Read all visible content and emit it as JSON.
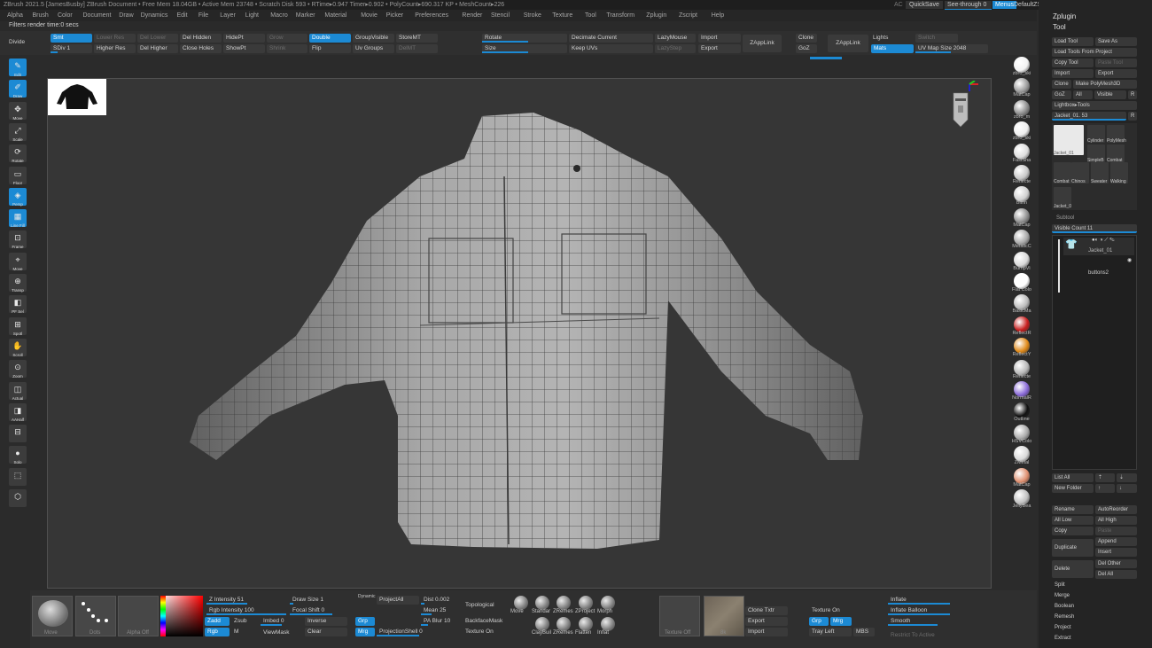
{
  "titlebar": {
    "text": "ZBrush 2021.5 [JamesBusby]  ZBrush Document    • Free Mem 18.04GB • Active Mem 23748 • Scratch Disk 593 • RTime▸0.947 Timer▸0.902 • PolyCount▸690.317 KP • MeshCount▸226",
    "ac": "AC",
    "quicksave": "QuickSave",
    "seethrough": "See-through  0",
    "menus": "Menus",
    "defaultzscript": "DefaultZScript"
  },
  "menubar": [
    "Alpha",
    "Brush",
    "Color",
    "Document",
    "Draw",
    "Dynamics",
    "Edit",
    "File",
    "Layer",
    "Light",
    "Macro",
    "Marker",
    "Material",
    "Movie",
    "Picker",
    "Preferences",
    "Render",
    "Stencil",
    "Stroke",
    "Texture",
    "Tool",
    "Transform",
    "Zplugin",
    "Zscript",
    "Help"
  ],
  "notice": "Filters render time:0 secs",
  "top_palette": {
    "divide": "Divide",
    "sdiv_label": "Smt",
    "sdiv_value": "SDiv 1",
    "lower_res": "Lower Res",
    "higher_res": "Higher Res",
    "del_lower": "Del Lower",
    "del_higher": "Del Higher",
    "del_hidden": "Del Hidden",
    "close_holes": "Close Holes",
    "hide_pt": "HidePt",
    "show_pt": "ShowPt",
    "grow": "Grow",
    "shrink": "Shrink",
    "double": "Double",
    "flip": "Flip",
    "group_visible": "GroupVisible",
    "uv_groups": "Uv Groups",
    "store_mt": "StoreMT",
    "del_mt": "DelMT",
    "rotate": "Rotate",
    "size": "Size",
    "decimate_current": "Decimate Current",
    "keep_uvs": "Keep UVs",
    "lazymouse": "LazyMouse",
    "lazystep": "LazyStep",
    "import": "Import",
    "export": "Export",
    "zapplink": "ZAppLink",
    "clone": "Clone",
    "goz": "GoZ",
    "zapplink2": "ZAppLink",
    "lights": "Lights",
    "switch": "Switch",
    "mats": "Mats",
    "uv_map_size": "UV Map Size 2048"
  },
  "left_shelf": [
    {
      "glyph": "✎",
      "cap": "Edit",
      "on": true
    },
    {
      "glyph": "✐",
      "cap": "Draw",
      "on": true
    },
    {
      "glyph": "✥",
      "cap": "Move",
      "on": false
    },
    {
      "glyph": "⤢",
      "cap": "Scale",
      "on": false
    },
    {
      "glyph": "⟳",
      "cap": "Rotate",
      "on": false
    },
    {
      "glyph": "▭",
      "cap": "Floor",
      "on": false
    },
    {
      "glyph": "◈",
      "cap": "Persp",
      "on": true
    },
    {
      "glyph": "▦",
      "cap": "Line Fill",
      "on": true
    },
    {
      "glyph": "⊡",
      "cap": "Frame",
      "on": false
    },
    {
      "glyph": "⌖",
      "cap": "Move",
      "on": false
    },
    {
      "glyph": "⊕",
      "cap": "Transp",
      "on": false
    },
    {
      "glyph": "◧",
      "cap": "PF Sel",
      "on": false
    },
    {
      "glyph": "⊞",
      "cap": "Spotl",
      "on": false
    },
    {
      "glyph": "✋",
      "cap": "Scroll",
      "on": false
    },
    {
      "glyph": "⊙",
      "cap": "Zoom",
      "on": false
    },
    {
      "glyph": "◫",
      "cap": "Actual",
      "on": false
    },
    {
      "glyph": "◨",
      "cap": "AAHalf",
      "on": false
    },
    {
      "glyph": "⊟",
      "cap": "",
      "on": false
    },
    {
      "glyph": "●",
      "cap": "Solo",
      "on": false
    },
    {
      "glyph": "⬚",
      "cap": "",
      "on": false
    },
    {
      "glyph": "⬡",
      "cap": "",
      "on": false
    }
  ],
  "materials": [
    {
      "name": "zbro_ski",
      "color": "#f2f2f2"
    },
    {
      "name": "MatCap",
      "color": "#9a9a9a"
    },
    {
      "name": "zbro_m",
      "color": "#8c8c8c"
    },
    {
      "name": "zbro_ski",
      "color": "#eeeeee"
    },
    {
      "name": "FastSha",
      "color": "#dddddd"
    },
    {
      "name": "Reflecte",
      "color": "#c8c8c8"
    },
    {
      "name": "Blinn",
      "color": "#d0d0d0"
    },
    {
      "name": "MatCap",
      "color": "#8f8f8f"
    },
    {
      "name": "MetalicC",
      "color": "#a8a8a8"
    },
    {
      "name": "BumpVi",
      "color": "#d8d8d8"
    },
    {
      "name": "Flat Colo",
      "color": "#ffffff"
    },
    {
      "name": "BasicMa",
      "color": "#bbbbbb"
    },
    {
      "name": "ReflectR",
      "color": "#c81f1f"
    },
    {
      "name": "ReflectY",
      "color": "#e08a1a"
    },
    {
      "name": "Reflecte",
      "color": "#b8b8b8"
    },
    {
      "name": "NormalR",
      "color": "#8a6ad8"
    },
    {
      "name": "Outline",
      "color": "#111111"
    },
    {
      "name": "HSVColo",
      "color": "#aaaaaa"
    },
    {
      "name": "ZMetal",
      "color": "#d9d9d9"
    },
    {
      "name": "MatCap",
      "color": "#e09070"
    },
    {
      "name": "JellyBea",
      "color": "#c0c0c0"
    }
  ],
  "right_panel": {
    "zplugin": "Zplugin",
    "tool": "Tool",
    "load_tool": "Load Tool",
    "save_as": "Save As",
    "load_tools_from_project": "Load Tools From Project",
    "copy_tool": "Copy Tool",
    "paste_tool": "Paste Tool",
    "import": "Import",
    "export": "Export",
    "clone": "Clone",
    "make_polymesh": "Make PolyMesh3D",
    "goz": "GoZ",
    "all": "All",
    "visible": "Visible",
    "r": "R",
    "lightbox_tools": "Lightbox▸Tools",
    "current_tool": "Jacket_01. 53",
    "tool_thumbs": [
      "Jacket_01",
      "Cylinder",
      "PolyMesh",
      "SimpleB",
      "Combat",
      "Combat",
      "Chinos",
      "Sweater",
      "Walking",
      "Jacket_0"
    ],
    "subtool": "Subtool",
    "visible_count": "Visible Count 11",
    "subtool_items": [
      "Jacket_01",
      "buttons2"
    ],
    "list_all": "List All",
    "new_folder": "New Folder",
    "rename": "Rename",
    "auto_reorder": "AutoReorder",
    "all_low": "All Low",
    "all_high": "All High",
    "copy": "Copy",
    "paste": "Paste",
    "duplicate": "Duplicate",
    "append": "Append",
    "insert": "Insert",
    "delete": "Delete",
    "del_other": "Del Other",
    "del_all": "Del All",
    "split": "Split",
    "merge": "Merge",
    "boolean": "Boolean",
    "remesh": "Remesh",
    "project": "Project",
    "extract": "Extract"
  },
  "bottom_palette": {
    "move": "Move",
    "dots": "Dots",
    "alpha_off": "Alpha Off",
    "zadd": "Zadd",
    "zsub": "Zsub",
    "rgb": "Rgb",
    "m": "M",
    "z_intensity": "Z Intensity 51",
    "rgb_intensity": "Rgb Intensity 100",
    "draw_size": "Draw Size 1",
    "dynamic": "Dynamic",
    "focal_shift": "Focal Shift 0",
    "imbed": "Imbed 0",
    "inverse": "Inverse",
    "clear": "Clear",
    "viewmask": "ViewMask",
    "projectall": "ProjectAll",
    "dist": "Dist 0.002",
    "mean": "Mean 25",
    "pa_blur": "PA Blur 10",
    "grp": "Grp",
    "mrg": "Mrg",
    "projection_shell": "ProjectionShell 0",
    "topological": "Topological",
    "backface_mask": "BackfaceMask",
    "texture_on": "Texture On",
    "brushes": [
      "Move",
      "Standar",
      "ZRemes",
      "ZProject",
      "Morph",
      "ClayBuil",
      "ZRemes",
      "Flatten",
      "Inflat"
    ],
    "texture_off": "Texture Off",
    "texture_id": "8k",
    "clone_txtr": "Clone Txtr",
    "export": "Export",
    "import": "Import",
    "texture_on2": "Texture On",
    "grp2": "Grp",
    "mrg2": "Mrg",
    "tray_left": "Tray Left",
    "mbs": "MBS",
    "inflate": "Inflate",
    "inflate_balloon": "Inflate Balloon",
    "smooth": "Smooth",
    "restrict_to_active": "Restrict To Active"
  }
}
